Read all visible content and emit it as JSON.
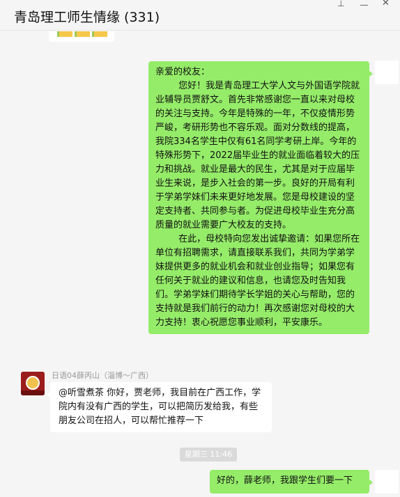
{
  "window": {
    "title": "青岛理工师生情缘 (331)"
  },
  "colors": {
    "self_bubble": "#95ec69",
    "other_bubble": "#ffffff",
    "background": "#f5f5f5"
  },
  "messages": [
    {
      "from": "self",
      "paragraphs": [
        "亲爱的校友：",
        "        您好！我是青岛理工大学人文与外国语学院就业辅导员贾舒文。首先非常感谢您一直以来对母校的关注与支持。今年是特殊的一年，不仅疫情形势严峻，考研形势也不容乐观。面对分数线的提高，我院334名学生中仅有61名同学考研上岸。今年的特殊形势下，2022届毕业生的就业面临着较大的压力和挑战。就业是最大的民生，尤其是对于应届毕业生来说，是步入社会的第一步。良好的开局有利于学弟学妹们未来更好地发展。您是母校建设的坚定支持者、共同参与者。为促进母校毕业生充分高质量的就业需要广大校友的支持。",
        "        在此，母校特向您发出诚挚邀请：如果您所在单位有招聘需求，请直接联系我们，共同为学弟学妹提供更多的就业机会和就业创业指导；如果您有任何关于就业的建议和信息，也请您及时告知我们。学弟学妹们期待学长学姐的关心与帮助，您的支持就是我们前行的动力！再次感谢您对母校的大力支持！衷心祝愿您事业顺利，平安康乐。"
      ]
    },
    {
      "from": "other",
      "sender": "日语04薛丙山（淄博～广西）",
      "text": "@听雪煮茶 你好，贾老师，我目前在广西工作，学院内有没有广西的学生，可以把简历发给我，有些朋友公司在招人，可以帮忙推荐一下"
    },
    {
      "timestamp": "星期三 11:46"
    },
    {
      "from": "self",
      "text": "好的，薛老师，我跟学生们要一下"
    }
  ],
  "icons": {
    "pin": "pin-icon",
    "minimize": "minimize-icon",
    "close": "close-icon"
  }
}
